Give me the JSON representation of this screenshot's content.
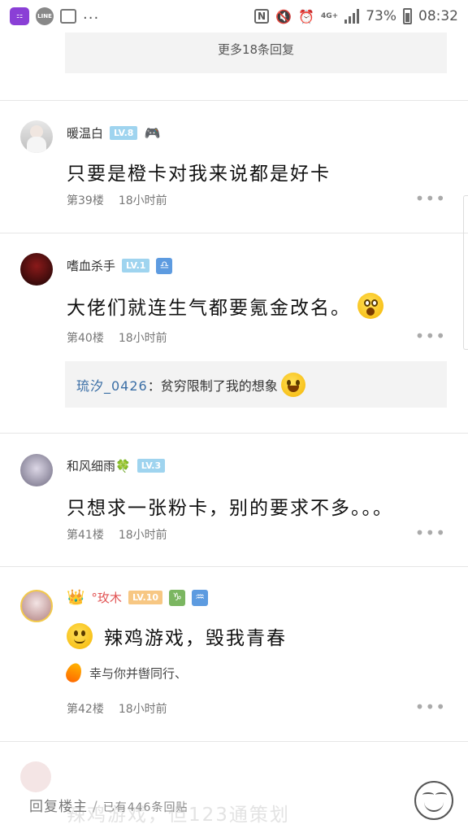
{
  "status_bar": {
    "apps": [
      "LINE"
    ],
    "dots": "...",
    "network": "4G+",
    "battery": "73%",
    "time": "08:32"
  },
  "more_replies": "更多18条回复",
  "posts": [
    {
      "username": "暖温白",
      "level": "LV.8",
      "text": "只要是橙卡对我来说都是好卡",
      "floor": "第39楼",
      "time": "18小时前"
    },
    {
      "username": "嗜血杀手",
      "level": "LV.1",
      "text": "大佬们就连生气都要氪金改名。",
      "floor": "第40楼",
      "time": "18小时前",
      "reply": {
        "user": "琉汐_0426",
        "colon": "：",
        "text": "贫穷限制了我的想象"
      }
    },
    {
      "username": "和风细雨",
      "level": "LV.3",
      "text": "只想求一张粉卡，别的要求不多。。。",
      "floor": "第41楼",
      "time": "18小时前"
    },
    {
      "username": "°玫木",
      "level": "LV.10",
      "text": "辣鸡游戏，毁我青春",
      "signature": "幸与你并辔同行、",
      "floor": "第42楼",
      "time": "18小时前"
    }
  ],
  "ghost_post": {
    "text": "辣鸡游戏，但123通策划"
  },
  "bottom_bar": {
    "reply_label": "回复楼主",
    "separator": "/",
    "count_text": "已有446条回贴"
  },
  "more_icon": "•••",
  "colors": {
    "level_blue": "#9fd4ef",
    "level_orange": "#f7c783",
    "reply_user": "#3a6ea5",
    "more_box_bg": "#f3f3f3"
  }
}
